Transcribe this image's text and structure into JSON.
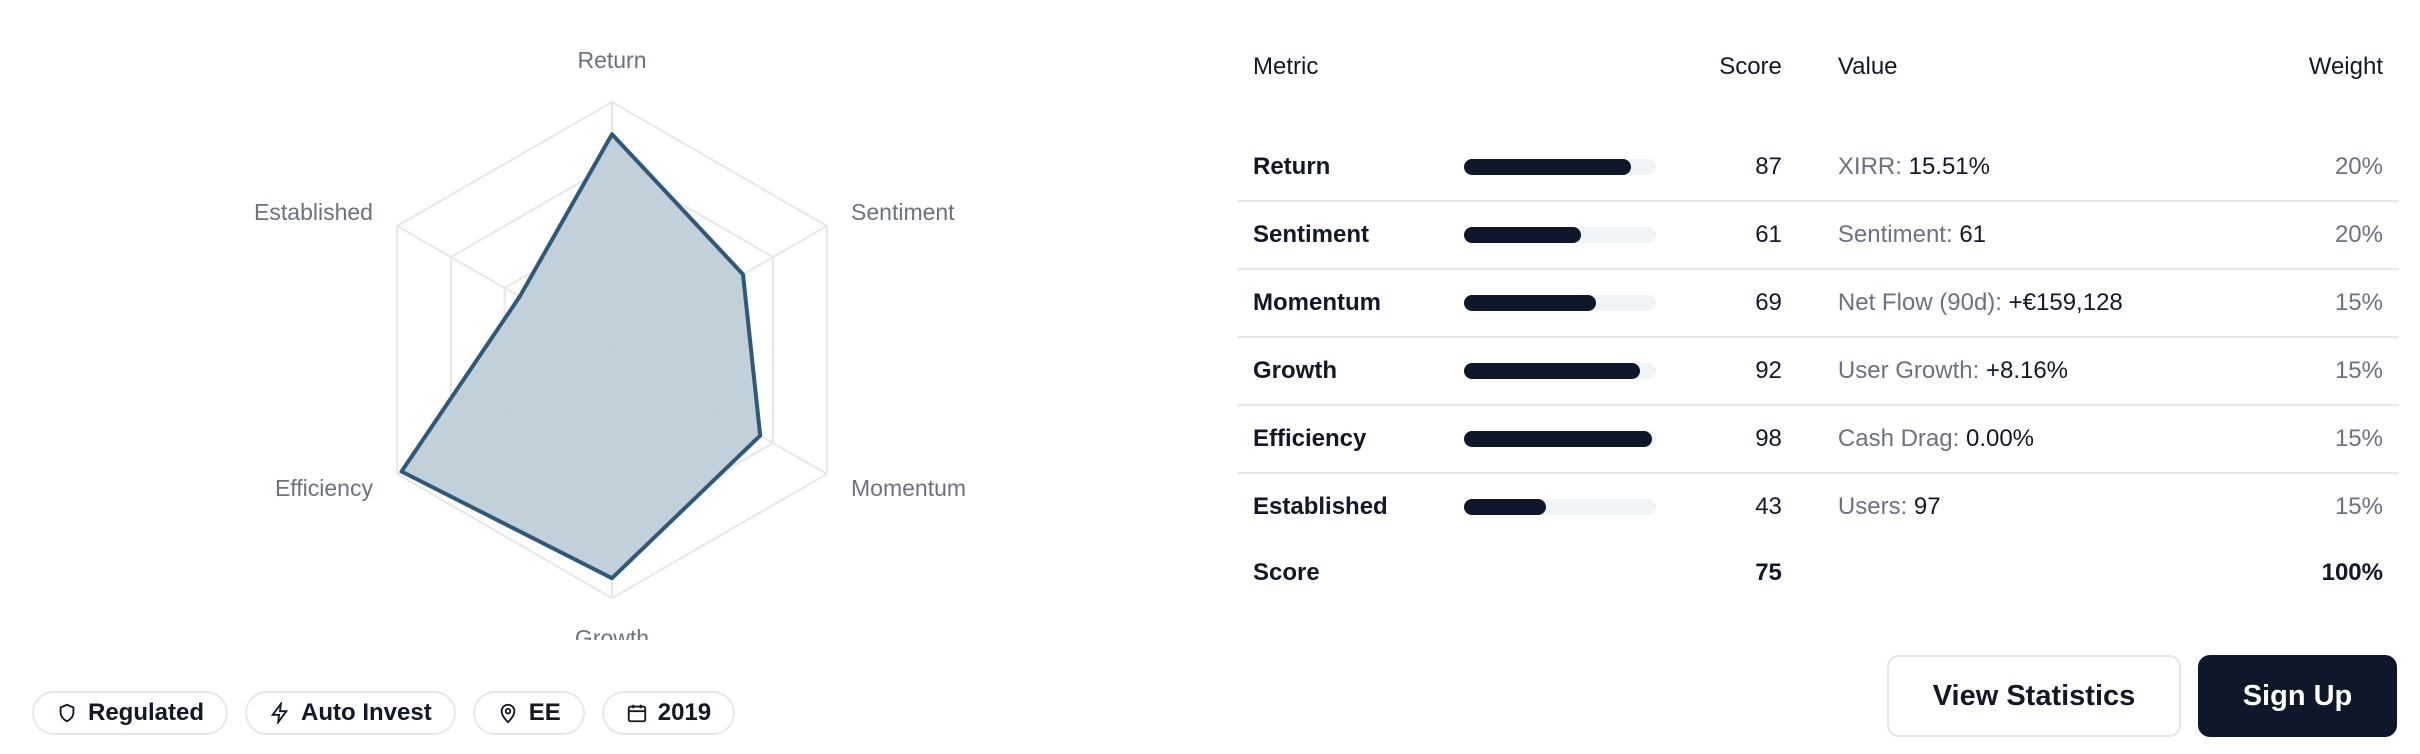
{
  "radar": {
    "axes": [
      "Return",
      "Sentiment",
      "Momentum",
      "Growth",
      "Efficiency",
      "Established"
    ],
    "values": [
      87,
      61,
      69,
      92,
      98,
      43
    ],
    "max": 100,
    "fill_color": "#bfcdd7",
    "stroke_color": "#2d5a7a"
  },
  "table": {
    "headers": {
      "metric": "Metric",
      "score": "Score",
      "value": "Value",
      "weight": "Weight"
    },
    "rows": [
      {
        "metric": "Return",
        "score": 87,
        "score_text": "87",
        "value_label": "XIRR:",
        "value": "15.51%",
        "weight": "20%"
      },
      {
        "metric": "Sentiment",
        "score": 61,
        "score_text": "61",
        "value_label": "Sentiment:",
        "value": "61",
        "weight": "20%"
      },
      {
        "metric": "Momentum",
        "score": 69,
        "score_text": "69",
        "value_label": "Net Flow (90d):",
        "value": "+€159,128",
        "weight": "15%"
      },
      {
        "metric": "Growth",
        "score": 92,
        "score_text": "92",
        "value_label": "User Growth:",
        "value": "+8.16%",
        "weight": "15%"
      },
      {
        "metric": "Efficiency",
        "score": 98,
        "score_text": "98",
        "value_label": "Cash Drag:",
        "value": "0.00%",
        "weight": "15%"
      },
      {
        "metric": "Established",
        "score": 43,
        "score_text": "43",
        "value_label": "Users:",
        "value": "97",
        "weight": "15%"
      }
    ],
    "total": {
      "label": "Score",
      "score": "75",
      "weight": "100%"
    }
  },
  "badges": [
    {
      "icon": "shield-icon",
      "label": "Regulated"
    },
    {
      "icon": "lightning-icon",
      "label": "Auto Invest"
    },
    {
      "icon": "location-pin-icon",
      "label": "EE"
    },
    {
      "icon": "calendar-icon",
      "label": "2019"
    }
  ],
  "actions": {
    "secondary_label": "View Statistics",
    "primary_label": "Sign Up"
  }
}
